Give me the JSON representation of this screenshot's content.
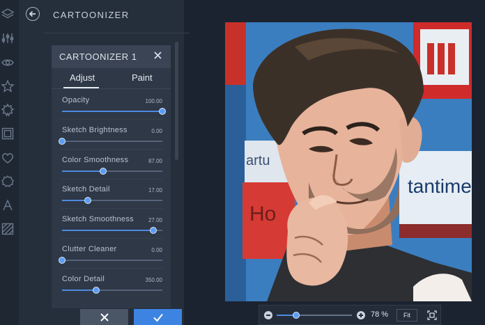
{
  "sidebar": {
    "icons": [
      "layers-icon",
      "sliders-icon",
      "eye-icon",
      "star-icon",
      "gear-burst-icon",
      "frame-icon",
      "heart-icon",
      "badge-icon",
      "text-icon",
      "texture-icon"
    ]
  },
  "panel": {
    "title": "CARTOONIZER",
    "card_title": "CARTOONIZER 1",
    "tabs": [
      {
        "label": "Adjust",
        "active": true
      },
      {
        "label": "Paint",
        "active": false
      }
    ],
    "sliders": [
      {
        "label": "Opacity",
        "value": "100.00",
        "fraction": 1.0
      },
      {
        "label": "Sketch Brightness",
        "value": "0.00",
        "fraction": 0.0
      },
      {
        "label": "Color Smoothness",
        "value": "87.00",
        "fraction": 0.41
      },
      {
        "label": "Sketch Detail",
        "value": "17.00",
        "fraction": 0.26
      },
      {
        "label": "Sketch Smoothness",
        "value": "27.00",
        "fraction": 0.91
      },
      {
        "label": "Clutter Cleaner",
        "value": "0.00",
        "fraction": 0.0
      },
      {
        "label": "Color Detail",
        "value": "350.00",
        "fraction": 0.34
      }
    ]
  },
  "zoom": {
    "value": "78 %",
    "fraction": 0.26,
    "fit_label": "Fit"
  },
  "colors": {
    "accent": "#3d83e2",
    "panel_bg": "#252e3b",
    "app_bg": "#1c2330"
  }
}
